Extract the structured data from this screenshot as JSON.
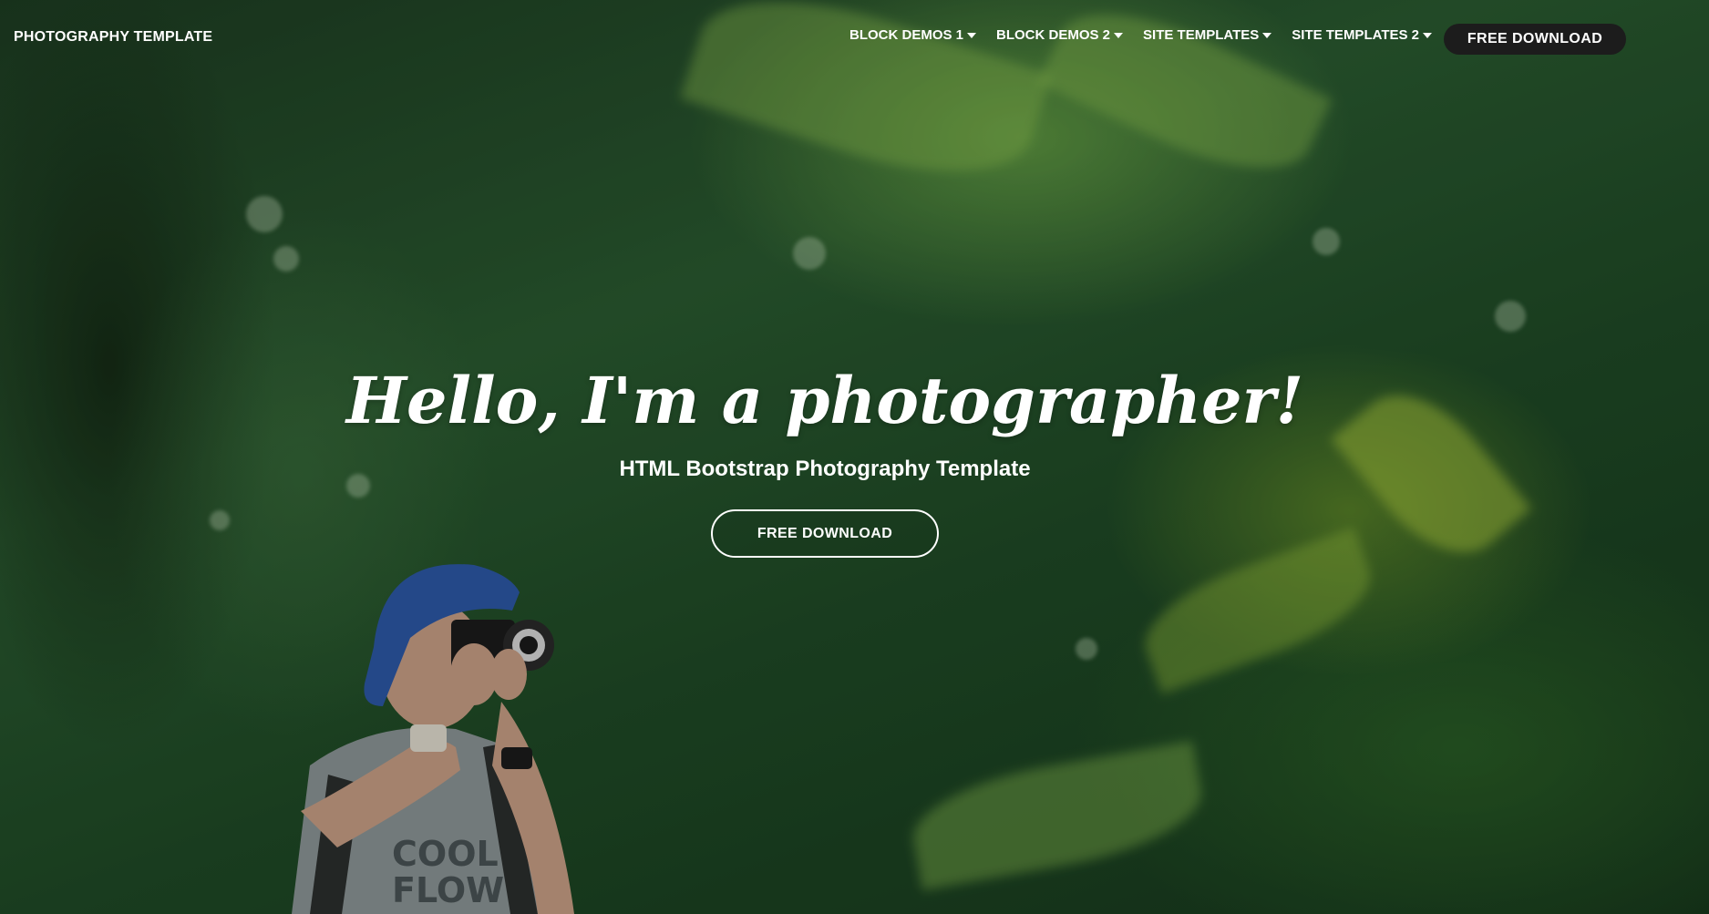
{
  "navbar": {
    "brand": "PHOTOGRAPHY TEMPLATE",
    "items": [
      {
        "label": "BLOCK DEMOS 1"
      },
      {
        "label": "BLOCK DEMOS 2"
      },
      {
        "label": "SITE TEMPLATES"
      },
      {
        "label": "SITE TEMPLATES 2"
      }
    ],
    "cta_label": "FREE DOWNLOAD"
  },
  "hero": {
    "title": "Hello, I'm a photographer!",
    "subtitle": "HTML Bootstrap Photography Template",
    "button_label": "FREE DOWNLOAD"
  },
  "colors": {
    "nav_cta_bg": "#1c1c1c",
    "text": "#ffffff"
  }
}
